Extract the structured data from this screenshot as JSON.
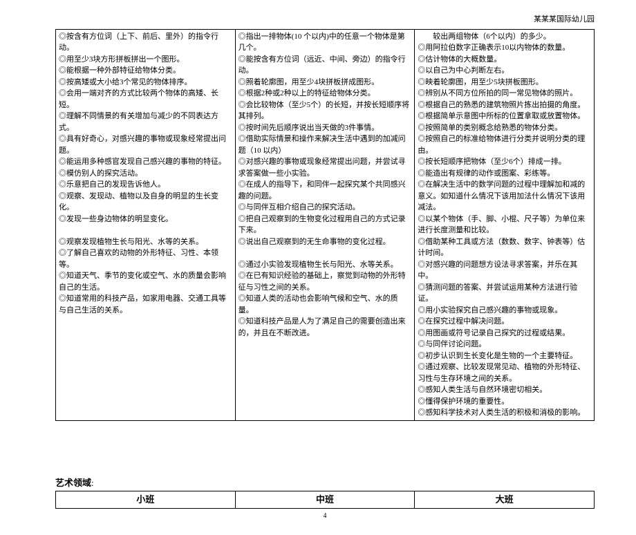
{
  "header": "某某某国际幼儿园",
  "table": {
    "columns": [
      {
        "items": [
          "◎按含有方位词（上下、前后、里外）的指令行动。",
          "◎用至少3块方形拼板拼出一个图形。",
          "◎能根据一种外部特征给物体分类。",
          "◎按高矮或大小给3个常见的物体排序。",
          "◎会用一端对齐的方式比较两个物体的高矮、长短。",
          "◎理解不同情景的有关增加与减少的不同表达方式。",
          "◎具有好奇心，对感兴趣的事物或现象经常提出问题。",
          "◎能运用多种感官发现自己感兴趣的事物的特征。",
          "◎模仿别人的探究活动。",
          "◎乐意把自己的发现告诉他人。",
          "◎观察、发现动、植物以及自身的明显的生长变化。",
          "◎发现一些身边物体的明显变化。",
          "",
          "◎观察发现植物生长与阳光、水等的关系。",
          "◎了解自己喜欢的动物的外形特征、习性、本领等。",
          "◎知道天气、季节的变化或空气、水的质量会影响自己的生活。",
          "◎知道常用的科技产品，如家用电器、交通工具等与自己生活的关系。"
        ]
      },
      {
        "items": [
          "◎指出一排物体(10 个以内)中的任意一个物体是第几个。",
          "◎能按含有方位词（远近、中间、旁边）的指令行动。",
          "◎照着轮廓图，用至少4块拼板拼成图形。",
          "◎根据2种或2种以上的特征给物体分类。",
          "◎会比较物体（至少5个）的长短，并按长短顺序将其排列。",
          "◎按时间先后顺序说出当天做的3件事情。",
          "◎借助实际情景和操作来解决生活中遇到的加减问题（10 以内）",
          "◎对感兴趣的事物或现象经常提出问题，并尝试寻求答案做一些小实验。",
          "◎在成人的指导下，和同伴一起探究某个共同感兴趣的问题。",
          "◎与同伴互相介绍自己的探究活动。",
          "◎把自己观察到的生物变化过程用自己的方式记录下来。",
          "◎说出自己观察到的无生命事物的变化过程。",
          "",
          "◎通过小实验发现植物生长与阳光、水等关系。",
          "◎在已有知识经验的基础上，察觉到动物的外形特征与习性之间的关系。",
          "◎知道人类的活动也会影响气候和空气、水的质量。",
          "◎知道科技产品是人为了满足自己的需要创造出来的，并且在不断改进。"
        ]
      },
      {
        "items": [
          "　　较出两组物体（6个以内）的多少。",
          "◎用阿拉伯数字正确表示10以内物体的数量。",
          "◎估计物体的大概数量。",
          "◎以自己为中心判断左右。",
          "◎映着轮廓图，用至少5块拼板图形。",
          "◎辨别从不同方位所拍的同一常见物体的照片。",
          "◎根据自己的熟悉的建筑物照片拣出拍摄的角度。",
          "◎根据简单示意图中所标的位置拿取或放置物体。",
          "◎按照简单的类别概念给熟悉的物体分类。",
          "◎按照自己的标准给物体进行分类并说明分类的理由。",
          "◎按长短顺序把物体（至少6个）排成一排。",
          "◎能造出有规律的动作或图案、彩练等。",
          "◎在解决生活中的数学问题的过程中理解加和减的意义。如知道什么情况下该用加法什么情况下该用减法。",
          "◎以某个物体（手、脚、小棍、尺子等）为单位来进行长度测量和比较。",
          "◎借助某种工具或方法（数数、数字、钟表等）估计时间。",
          "◎对感兴趣的问题想方设法寻求答案，并乐在其中。",
          "◎猜测问题的答案、并尝试运用某种方法进行验证。",
          "◎用小实验探究自己感兴趣的事物或现象。",
          "◎在探究过程中解决问题。",
          "◎用图画或符号记录自己探究的过程或结果。",
          "◎与同伴讨论问题。",
          "◎初步认识到生长变化是生物的一个主要特征。",
          "◎通过观察、比较发现常见动、植物的外形特征、习性与生存环境之间的关系。",
          "◎感知人类生活与自然环境密切相关。",
          "◎懂得保护环境的重要性。",
          "◎感知科学技术对人类生活的积极和消极的影响。"
        ]
      }
    ]
  },
  "section_label": "艺术领域",
  "section_colon": ":",
  "levels": [
    "小班",
    "中班",
    "大班"
  ],
  "page_number": "4"
}
